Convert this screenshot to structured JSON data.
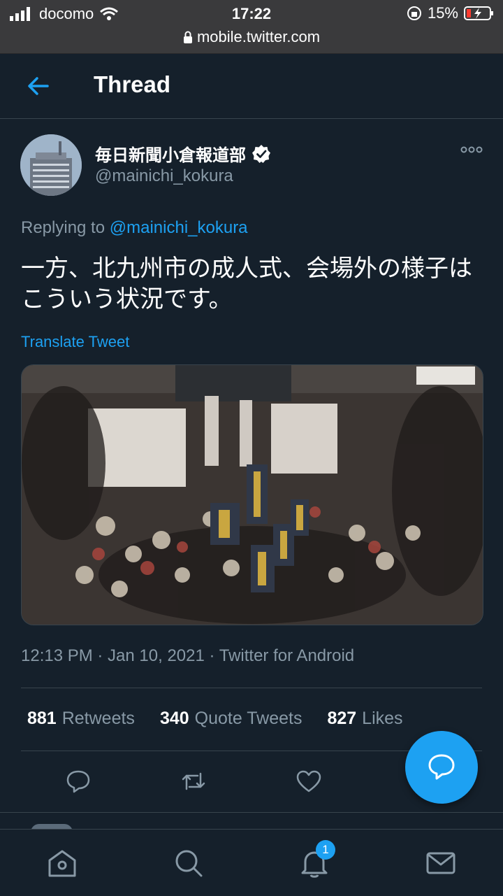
{
  "status_bar": {
    "carrier": "docomo",
    "time": "17:22",
    "battery": "15%"
  },
  "browser": {
    "url": "mobile.twitter.com"
  },
  "header": {
    "title": "Thread"
  },
  "tweet": {
    "author_name": "毎日新聞小倉報道部",
    "author_handle": "@mainichi_kokura",
    "replying_prefix": "Replying to",
    "replying_to": "@mainichi_kokura",
    "text": "一方、北九州市の成人式、会場外の様子はこういう状況です。",
    "translate_label": "Translate Tweet",
    "meta": "12:13 PM · Jan 10, 2021 · Twitter for Android",
    "stats": {
      "retweets_count": "881",
      "retweets_label": "Retweets",
      "quotes_count": "340",
      "quotes_label": "Quote Tweets",
      "likes_count": "827",
      "likes_label": "Likes"
    }
  },
  "notifications_badge": "1",
  "colors": {
    "background": "#15202b",
    "accent": "#1da1f2",
    "secondary_text": "#8899a6",
    "divider": "#38444d"
  }
}
